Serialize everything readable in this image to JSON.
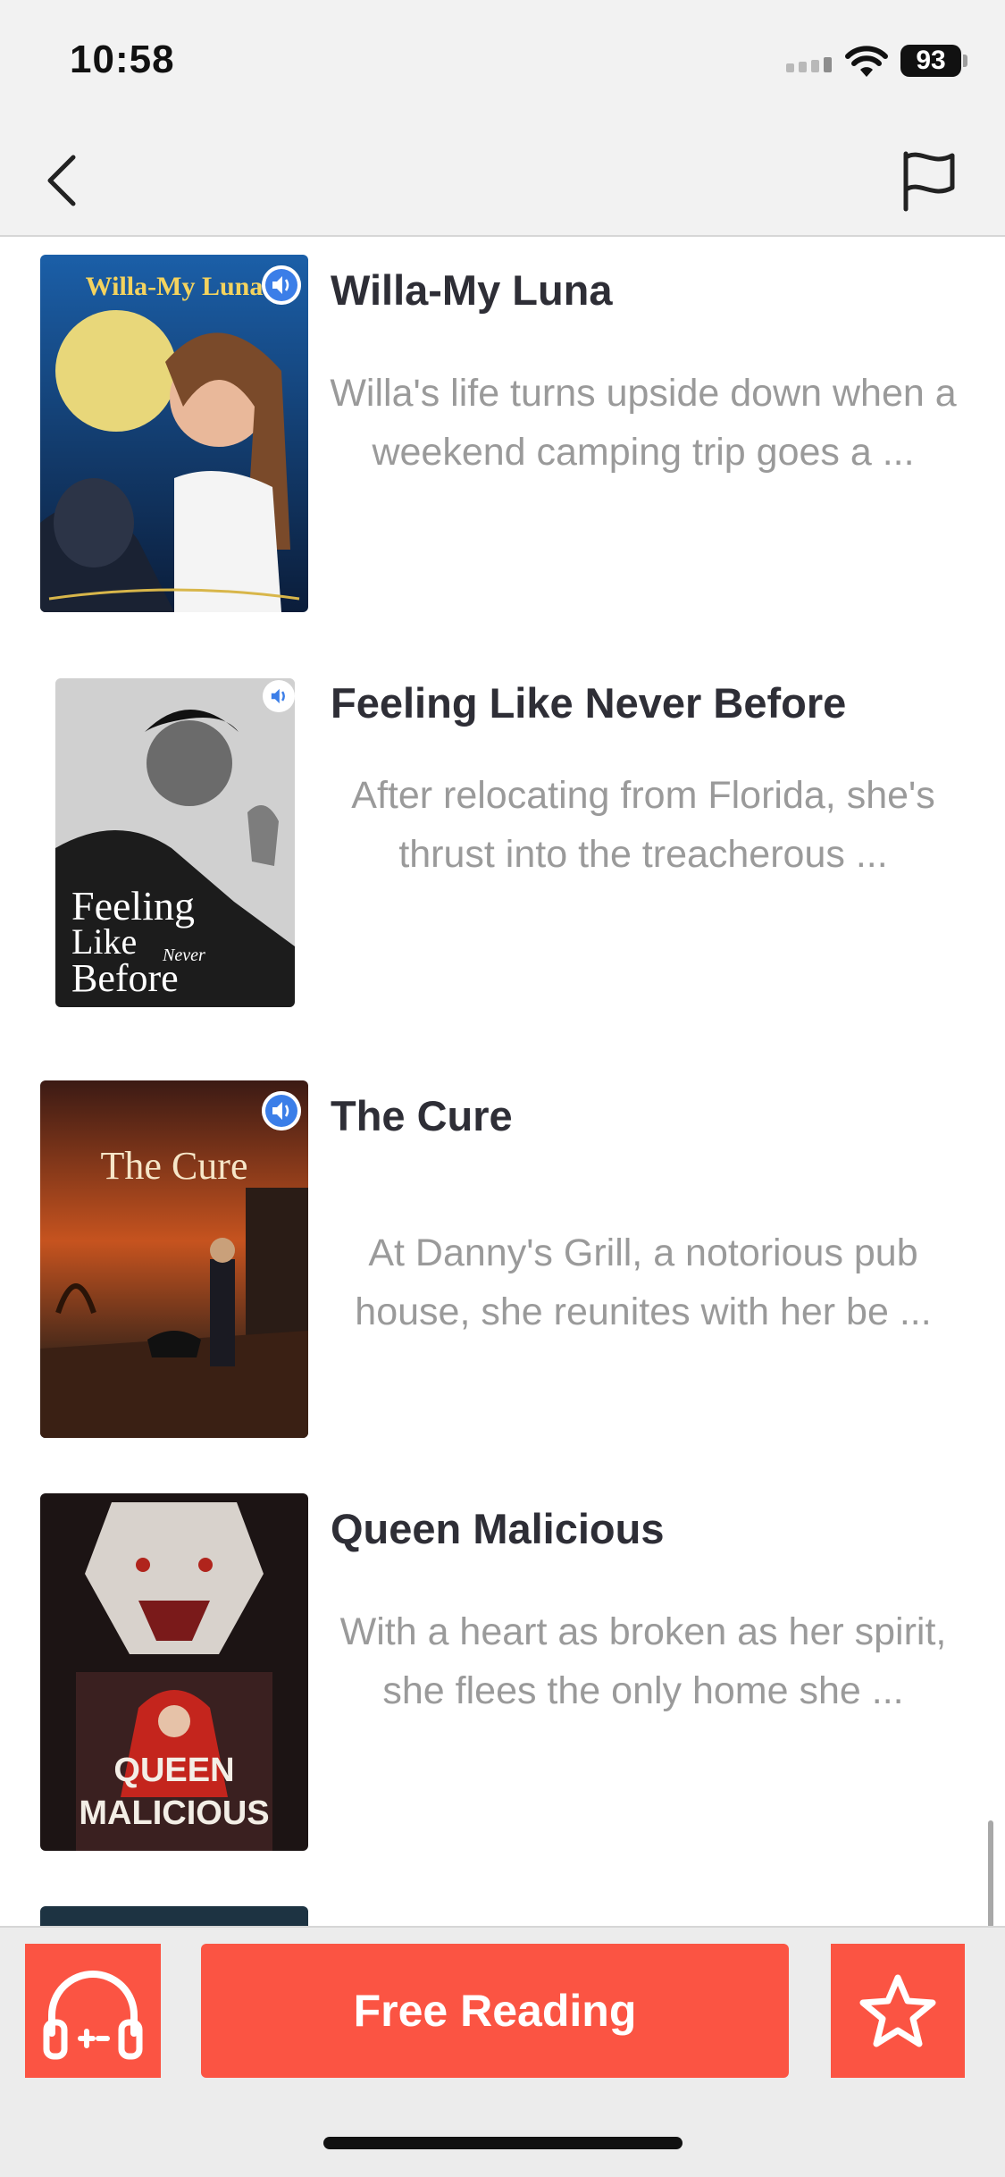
{
  "status_bar": {
    "time": "10:58",
    "battery": "93"
  },
  "nav": {
    "back_icon": "chevron-left-icon",
    "report_icon": "flag-icon"
  },
  "books": [
    {
      "title": "Willa-My Luna",
      "description": "Willa's life turns upside down when a weekend camping trip goes a ...",
      "cover_title": "Willa-My Luna",
      "has_audio": true
    },
    {
      "title": "Feeling Like Never Before",
      "description": "After relocating from Florida, she's thrust into the treacherous  ...",
      "cover_title": [
        "Feeling",
        "Like",
        "Never",
        "Before"
      ],
      "has_audio": true
    },
    {
      "title": "The Cure",
      "description": "At Danny's Grill, a notorious pub house, she reunites with her be ...",
      "cover_title": "The Cure",
      "has_audio": true
    },
    {
      "title": "Queen Malicious",
      "description": "With a heart as broken as her spirit, she flees the only home she ...",
      "cover_title": [
        "QUEEN",
        "MALICIOUS"
      ],
      "has_audio": false
    }
  ],
  "bottom_bar": {
    "listen_icon": "headphones-icon",
    "free_reading_label": "Free Reading",
    "favorite_icon": "star-icon"
  },
  "colors": {
    "accent": "#fb5443",
    "audio_badge": "#3b7ee8"
  }
}
